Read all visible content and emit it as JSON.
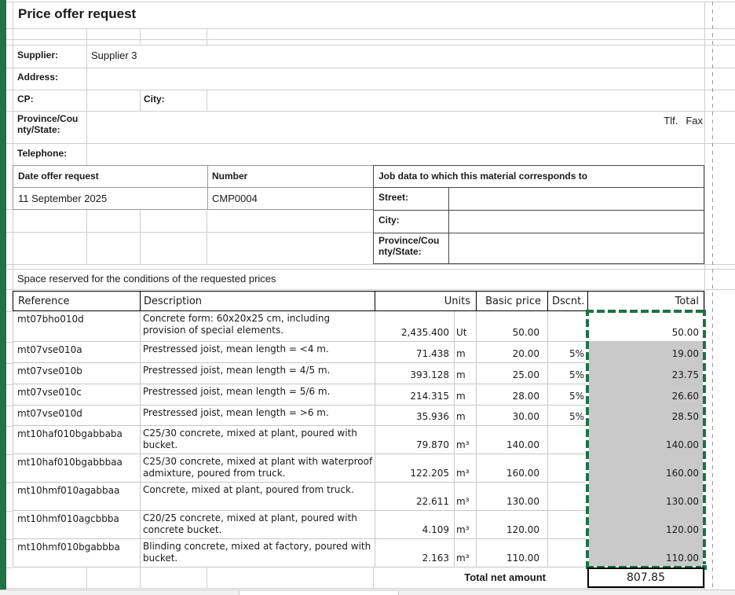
{
  "title": "Price offer request",
  "supplier_form": {
    "supplier_label": "Supplier:",
    "supplier_value": "Supplier 3",
    "address_label": "Address:",
    "cp_label": "CP:",
    "city_label": "City:",
    "province_label": "Province/County/State:",
    "telephone_label": "Telephone:",
    "tlf_label": "Tlf.",
    "fax_label": "Fax"
  },
  "request_info": {
    "date_label": "Date offer request",
    "date_value": "11 September 2025",
    "number_label": "Number",
    "number_value": "CMP0004"
  },
  "job_info": {
    "header": "Job data to which this material corresponds to",
    "street_label": "Street:",
    "city_label": "City:",
    "province_label": "Province/County/State:"
  },
  "conditions_note": "Space reserved for the conditions of the requested prices",
  "price_table": {
    "headers": {
      "reference": "Reference",
      "description": "Description",
      "units": "Units",
      "basic_price": "Basic price",
      "discount": "Dscnt.",
      "total": "Total"
    },
    "rows": [
      {
        "reference": "mt07bho010d",
        "description": "Concrete form: 60x20x25 cm, including provision of special elements.",
        "quantity": "2,435.400",
        "unit": "Ut",
        "basic_price": "50.00",
        "discount": "",
        "total": "50.00",
        "shaded": false
      },
      {
        "reference": "mt07vse010a",
        "description": "Prestressed joist, mean length = <4 m.",
        "quantity": "71.438",
        "unit": "m",
        "basic_price": "20.00",
        "discount": "5%",
        "total": "19.00",
        "shaded": true
      },
      {
        "reference": "mt07vse010b",
        "description": "Prestressed joist, mean length = 4/5 m.",
        "quantity": "393.128",
        "unit": "m",
        "basic_price": "25.00",
        "discount": "5%",
        "total": "23.75",
        "shaded": true
      },
      {
        "reference": "mt07vse010c",
        "description": "Prestressed joist, mean length = 5/6 m.",
        "quantity": "214.315",
        "unit": "m",
        "basic_price": "28.00",
        "discount": "5%",
        "total": "26.60",
        "shaded": true
      },
      {
        "reference": "mt07vse010d",
        "description": "Prestressed joist, mean length = >6 m.",
        "quantity": "35.936",
        "unit": "m",
        "basic_price": "30.00",
        "discount": "5%",
        "total": "28.50",
        "shaded": true
      },
      {
        "reference": "mt10haf010bgabbaba",
        "description": "C25/30 concrete, mixed at plant, poured with bucket.",
        "quantity": "79.870",
        "unit": "m³",
        "basic_price": "140.00",
        "discount": "",
        "total": "140.00",
        "shaded": true
      },
      {
        "reference": "mt10haf010bgabbbaa",
        "description": "C25/30 concrete, mixed at plant with waterproof admixture, poured from truck.",
        "quantity": "122.205",
        "unit": "m³",
        "basic_price": "160.00",
        "discount": "",
        "total": "160.00",
        "shaded": true
      },
      {
        "reference": "mt10hmf010agabbaa",
        "description": "Concrete, mixed at plant, poured from truck.",
        "quantity": "22.611",
        "unit": "m³",
        "basic_price": "130.00",
        "discount": "",
        "total": "130.00",
        "shaded": true
      },
      {
        "reference": "mt10hmf010agcbbba",
        "description": "C20/25 concrete, mixed at plant, poured with concrete bucket.",
        "quantity": "4.109",
        "unit": "m³",
        "basic_price": "120.00",
        "discount": "",
        "total": "120.00",
        "shaded": true
      },
      {
        "reference": "mt10hmf010bgabbba",
        "description": "Blinding concrete, mixed at factory, poured with bucket.",
        "quantity": "2.163",
        "unit": "m³",
        "basic_price": "110.00",
        "discount": "",
        "total": "110.00",
        "shaded": true
      }
    ],
    "total_label": "Total net amount",
    "total_value": "807.85"
  },
  "colors": {
    "selection_green": "#1E7145",
    "margin_strip_green": "#217346",
    "shaded_cell": "#C9C9C9"
  }
}
